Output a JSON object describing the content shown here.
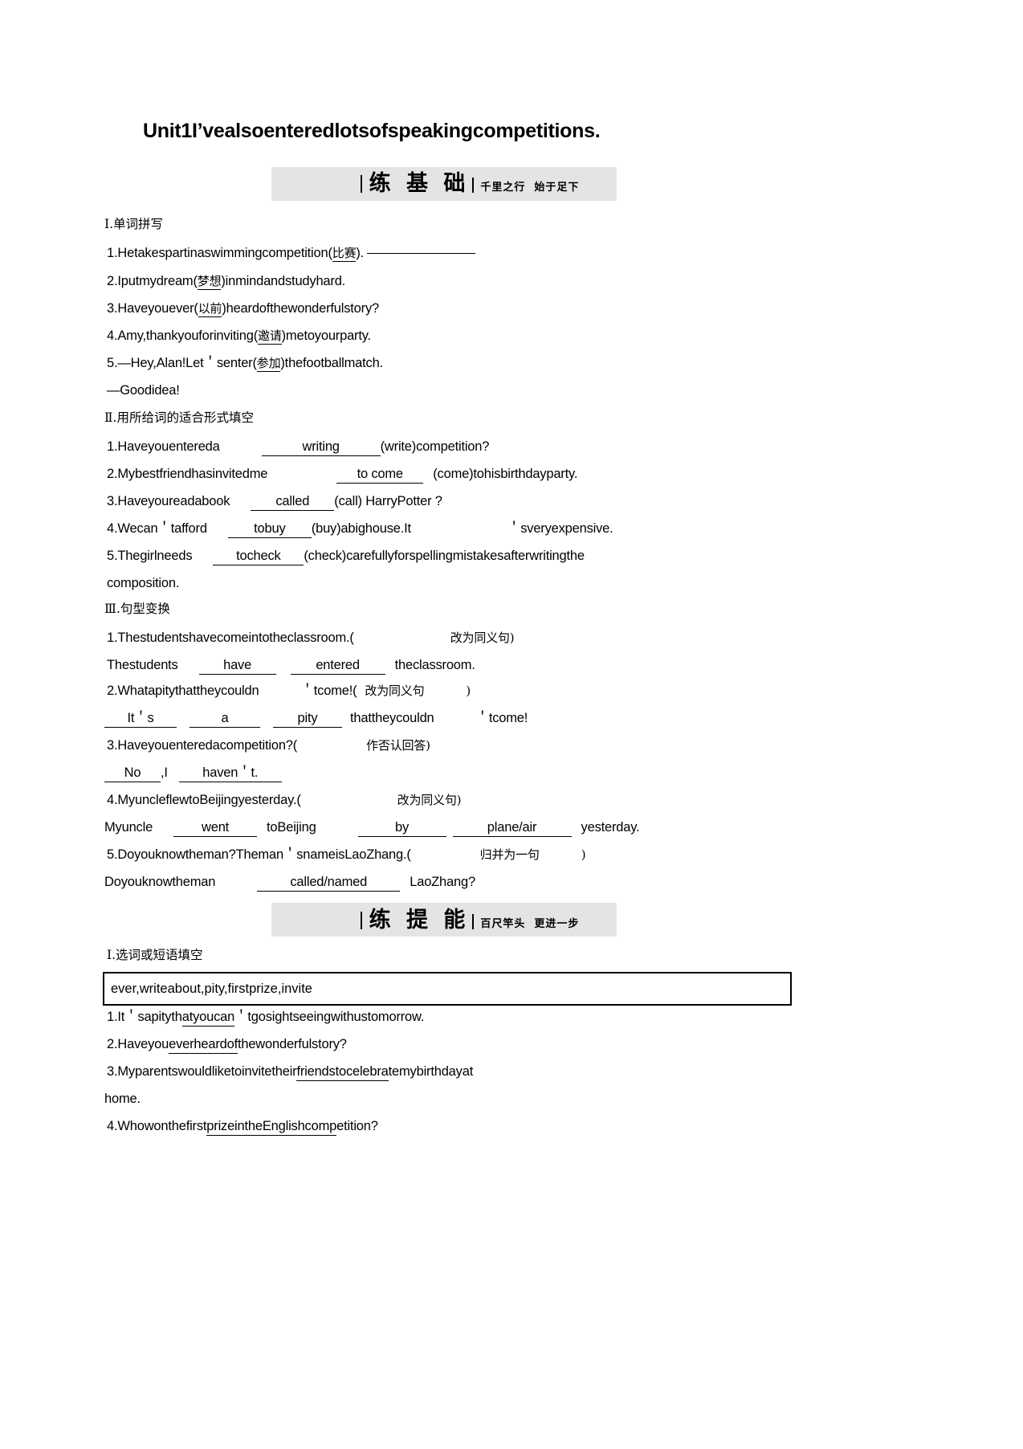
{
  "title": "Unit1I’vealsoenteredlotsofspeakingcompetitions.",
  "banners": [
    {
      "main": "练 基 础",
      "sub": "千里之行  始于足下"
    },
    {
      "main": "练 提 能",
      "sub": "百尺竿头  更进一步"
    }
  ],
  "section1": {
    "heading": "Ⅰ.单词拼写",
    "items": [
      {
        "num": "1.",
        "pre": "Hetakespartinaswimmingcompetition(",
        "hint": "比赛",
        "post": ")."
      },
      {
        "num": "2.",
        "pre": "Iputmydream(",
        "hint": "梦想",
        "post": ")inmindandstudyhard."
      },
      {
        "num": "3.",
        "pre": "Haveyouever(",
        "hint": "以前",
        "post": ")heardofthewonderfulstory?"
      },
      {
        "num": "4.",
        "pre": "Amy,thankyouforinviting(",
        "hint": "邀请",
        "post": ")metoyourparty."
      },
      {
        "num": "5.",
        "pre": "—Hey,Alan!Let＇senter(",
        "hint": "参加",
        "post": ")thefootballmatch."
      }
    ],
    "reply": "—Goodidea!"
  },
  "section2": {
    "heading": "Ⅱ.用所给词的适合形式填空",
    "items": [
      {
        "num": "1.",
        "pre": "Haveyouentereda",
        "answer": "writing",
        "post": "(write)competition?"
      },
      {
        "num": "2.",
        "pre": "Mybestfriendhasinvitedme",
        "answer": "to  come",
        "post": "(come)tohisbirthdayparty."
      },
      {
        "num": "3.",
        "pre": "Haveyoureadabook",
        "answer": "called",
        "post": "(call)   HarryPotter      ?"
      },
      {
        "num": "4.",
        "pre": "Wecan＇tafford",
        "answer": "tobuy",
        "post": "(buy)abighouse.It",
        "post2": "＇sveryexpensive."
      },
      {
        "num": "5.",
        "pre": "Thegirlneeds",
        "answer": "tocheck",
        "post": "(check)carefullyforspellingmistakesafterwritingthe"
      }
    ],
    "continuation": "composition."
  },
  "section3": {
    "heading": "Ⅲ.句型变换",
    "items": [
      {
        "num": "1.",
        "prompt": "Thestudentshavecomeintotheclassroom.(",
        "note": "改为同义句)",
        "answer_pre": "Thestudents",
        "answer1": "have",
        "answer2": "entered",
        "answer_post": "theclassroom."
      },
      {
        "num": "2.",
        "prompt": "Whatapitythattheycouldn",
        "prompt2": "＇tcome!(",
        "note": "改为同义句",
        "note2": ")",
        "answer1": "It＇s",
        "answer2": "a",
        "answer3": "pity",
        "answer_mid": "thattheycouldn",
        "answer_post": "＇tcome!"
      },
      {
        "num": "3.",
        "prompt": "Haveyouenteredacompetition?(",
        "note": "作否认回答)",
        "answer1": "No",
        "answer_mid": ",I",
        "answer2": "haven＇t."
      },
      {
        "num": "4.",
        "prompt": "MyuncleflewtoBeijingyesterday.(",
        "note": "改为同义句)",
        "answer_pre": "Myuncle",
        "answer1": "went",
        "answer_mid": "toBeijing",
        "answer2": "by",
        "answer3": "plane/air",
        "answer_post": "yesterday."
      },
      {
        "num": "5.",
        "prompt": "Doyouknowtheman?Theman＇snameisLaoZhang.(",
        "note": "归并为一句",
        "note2": ")",
        "answer_pre": "Doyouknowtheman",
        "answer1": "called/named",
        "answer_post": "LaoZhang?"
      }
    ]
  },
  "section4": {
    "heading": "Ⅰ.选词或短语填空",
    "wordbank": "ever,writeabout,pity,firstprize,invite",
    "items": [
      {
        "num": "1.",
        "pre": "It＇sapityth",
        "u": "atyoucan",
        "post": "＇tgosightseeingwithustomorrow."
      },
      {
        "num": "2.",
        "pre": "Haveyou",
        "u": "everheardof",
        "post": "thewonderfulstory?"
      },
      {
        "num": "3.",
        "pre": "Myparentswouldliketoinvitetheir",
        "u": "friendstocelebra",
        "post": "temybirthdayat",
        "cont": "home."
      },
      {
        "num": "4.",
        "pre": "Whowonthefirst",
        "u": "prizeintheEnglishcomp",
        "post": "etition?"
      }
    ]
  }
}
